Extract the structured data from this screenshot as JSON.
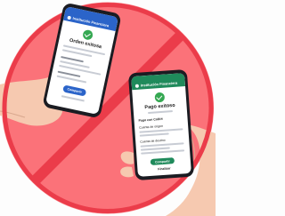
{
  "colors": {
    "background_circle": "#fb7279",
    "prohibition_ring": "#eb3c4a",
    "phone_frame": "#1b1c22",
    "left_app_accent": "#2b64c9",
    "right_app_accent": "#1f8a5b",
    "success_check": "#35a852",
    "skin": "#f6c9b0"
  },
  "left_phone": {
    "app_name": "Institución Financiera",
    "title": "Orden exitosa",
    "button_label": "Compartir",
    "check_icon": "check-circle-icon"
  },
  "right_phone": {
    "app_name": "Institución Financiera",
    "title": "Pago exitoso",
    "section_label": "Pago con CoDi®",
    "account_origin_label": "Cuenta de origen",
    "account_dest_label": "Cuenta de destino",
    "button_label": "Compartir",
    "finish_label": "Finalizar",
    "check_icon": "check-circle-icon"
  }
}
